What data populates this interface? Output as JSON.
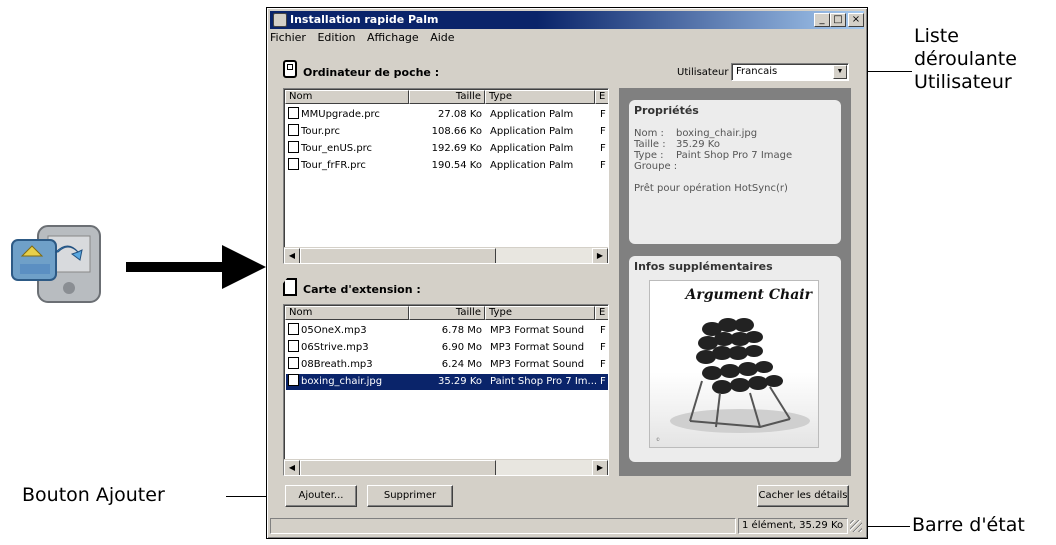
{
  "callouts": {
    "liste": "Liste\ndéroulante\nUtilisateur",
    "liste_l1": "Liste",
    "liste_l2": "déroulante",
    "liste_l3": "Utilisateur",
    "bouton_ajouter": "Bouton Ajouter",
    "barre_etat": "Barre d'état"
  },
  "window": {
    "title": "Installation rapide Palm",
    "controls": [
      "_",
      "□",
      "×"
    ]
  },
  "menu": [
    "Fichier",
    "Edition",
    "Affichage",
    "Aide"
  ],
  "handheld": {
    "label": "Ordinateur de poche :",
    "columns": [
      "Nom",
      "Taille",
      "Type",
      "E"
    ],
    "rows": [
      {
        "name": "MMUpgrade.prc",
        "size": "27.08 Ko",
        "type": "Application Palm",
        "extra": "F"
      },
      {
        "name": "Tour.prc",
        "size": "108.66 Ko",
        "type": "Application Palm",
        "extra": "F"
      },
      {
        "name": "Tour_enUS.prc",
        "size": "192.69 Ko",
        "type": "Application Palm",
        "extra": "F"
      },
      {
        "name": "Tour_frFR.prc",
        "size": "190.54 Ko",
        "type": "Application Palm",
        "extra": "F"
      }
    ]
  },
  "card_ext": {
    "label": "Carte d'extension :",
    "columns": [
      "Nom",
      "Taille",
      "Type",
      "E"
    ],
    "rows": [
      {
        "name": "05OneX.mp3",
        "size": "6.78 Mo",
        "type": "MP3 Format Sound",
        "extra": "F"
      },
      {
        "name": "06Strive.mp3",
        "size": "6.90 Mo",
        "type": "MP3 Format Sound",
        "extra": "F"
      },
      {
        "name": "08Breath.mp3",
        "size": "6.24 Mo",
        "type": "MP3 Format Sound",
        "extra": "F"
      },
      {
        "name": "boxing_chair.jpg",
        "size": "35.29 Ko",
        "type": "Paint Shop Pro 7 Im...",
        "extra": "F"
      }
    ]
  },
  "user": {
    "label": "Utilisateur :",
    "value": "Francais"
  },
  "properties": {
    "title": "Propriétés",
    "nom_label": "Nom :",
    "nom_value": "boxing_chair.jpg",
    "taille_label": "Taille :",
    "taille_value": "35.29 Ko",
    "type_label": "Type :",
    "type_value": "Paint Shop Pro 7 Image",
    "groupe_label": "Groupe :",
    "status": "Prêt pour opération HotSync(r)"
  },
  "extra_info": {
    "title": "Infos supplémentaires",
    "image_caption": "Argument Chair"
  },
  "buttons": {
    "add": "Ajouter...",
    "remove": "Supprimer",
    "hide_details": "Cacher les détails"
  },
  "statusbar": {
    "text": "1 élément, 35.29 Ko"
  }
}
